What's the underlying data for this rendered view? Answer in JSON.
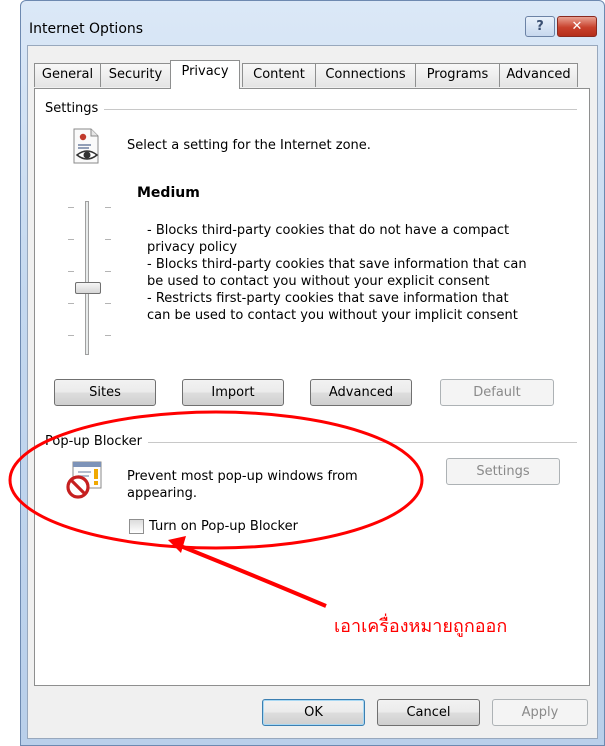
{
  "window": {
    "title": "Internet Options",
    "help_label": "?",
    "close_label": "✕"
  },
  "tabs": [
    {
      "label": "General"
    },
    {
      "label": "Security"
    },
    {
      "label": "Privacy"
    },
    {
      "label": "Content"
    },
    {
      "label": "Connections"
    },
    {
      "label": "Programs"
    },
    {
      "label": "Advanced"
    }
  ],
  "active_tab": "Privacy",
  "settings": {
    "group_label": "Settings",
    "intro": "Select a setting for the Internet zone.",
    "level_title": "Medium",
    "description": [
      "- Blocks third-party cookies that do not have a compact",
      "privacy policy",
      "- Blocks third-party cookies that save information that can",
      "be used to contact you without your explicit consent",
      "- Restricts first-party cookies that save information that",
      "can be used to contact you without your implicit consent"
    ],
    "slider_level": "Medium",
    "buttons": {
      "sites": "Sites",
      "import": "Import",
      "advanced": "Advanced",
      "default": "Default"
    }
  },
  "popup_blocker": {
    "group_label": "Pop-up Blocker",
    "description": [
      "Prevent most pop-up windows from",
      "appearing."
    ],
    "settings_button": "Settings",
    "checkbox_label": "Turn on Pop-up Blocker",
    "checkbox_checked": false
  },
  "annotation": {
    "note": "เอาเครื่องหมายถูกออก",
    "color": "#ff0000"
  },
  "footer": {
    "ok": "OK",
    "cancel": "Cancel",
    "apply": "Apply"
  },
  "icons": [
    "privacy-zone-icon",
    "popup-blocked-icon"
  ]
}
